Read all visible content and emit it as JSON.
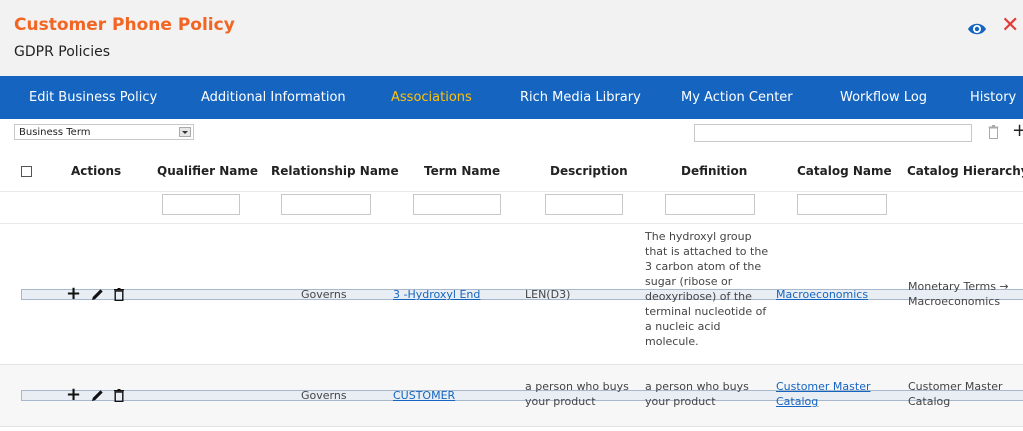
{
  "header": {
    "title": "Customer Phone Policy",
    "subtitle": "GDPR Policies",
    "title_color": "#f26522",
    "close_glyph": "✕"
  },
  "tabs": [
    {
      "label": "Edit Business Policy",
      "active": false
    },
    {
      "label": "Additional Information",
      "active": false
    },
    {
      "label": "Associations",
      "active": true
    },
    {
      "label": "Rich Media Library",
      "active": false
    },
    {
      "label": "My Action Center",
      "active": false
    },
    {
      "label": "Workflow Log",
      "active": false
    },
    {
      "label": "History",
      "active": false
    }
  ],
  "filter": {
    "selected_type": "Business Term",
    "add_glyph": "+"
  },
  "table": {
    "columns": [
      "Actions",
      "Qualifier Name",
      "Relationship Name",
      "Term Name",
      "Description",
      "Definition",
      "Catalog Name",
      "Catalog Hierarchy"
    ],
    "rows": [
      {
        "qualifier": "",
        "relationship": "Governs",
        "term": "3 -Hydroxyl End",
        "description": "LEN(D3)",
        "definition_lines": [
          "The hydroxyl group",
          "that is attached to the",
          "3 carbon atom of the",
          "sugar (ribose or",
          "deoxyribose) of the",
          "terminal nucleotide of",
          "a nucleic acid",
          "molecule."
        ],
        "catalog_lines": [
          "Macroeconomics"
        ],
        "hierarchy_lines": [
          "Monetary Terms →",
          "Macroeconomics"
        ]
      },
      {
        "qualifier": "",
        "relationship": "Governs",
        "term": "CUSTOMER",
        "description_lines": [
          "a person who buys",
          "your product"
        ],
        "definition_lines": [
          "a person who buys",
          "your product"
        ],
        "catalog_lines": [
          "Customer Master",
          "Catalog"
        ],
        "hierarchy_lines": [
          "Customer Master",
          "Catalog"
        ]
      }
    ],
    "action_plus_glyph": "+"
  },
  "colors": {
    "tab_bar": "#1565c0",
    "active_tab": "#ffc107",
    "link": "#1565c0",
    "close": "#e53935",
    "header_bg": "#f2f2f2"
  },
  "icons": [
    "eye-icon",
    "close-icon",
    "dropdown-arrow-icon",
    "trash-icon",
    "plus-icon",
    "pencil-icon"
  ]
}
